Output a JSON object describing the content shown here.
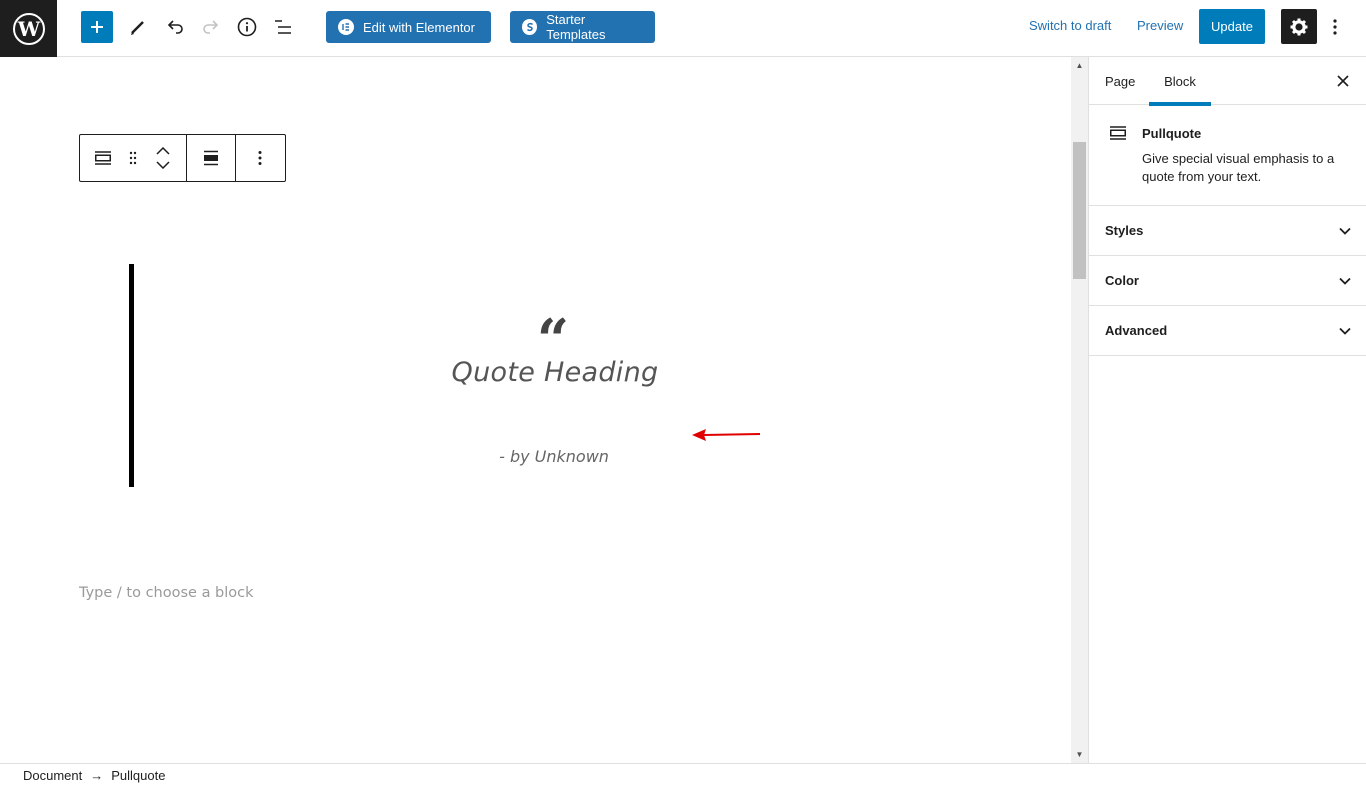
{
  "toolbar": {
    "edit_elementor_label": "Edit with Elementor",
    "starter_templates_label": "Starter Templates",
    "switch_to_draft_label": "Switch to draft",
    "preview_label": "Preview",
    "update_label": "Update"
  },
  "editor": {
    "quote_mark": "“",
    "quote_heading": "Quote Heading",
    "citation": "- by Unknown",
    "placeholder": "Type / to choose a block"
  },
  "sidebar": {
    "tabs": [
      {
        "label": "Page",
        "active": false
      },
      {
        "label": "Block",
        "active": true
      }
    ],
    "block": {
      "title": "Pullquote",
      "description": "Give special visual emphasis to a quote from your text."
    },
    "panels": [
      {
        "label": "Styles"
      },
      {
        "label": "Color"
      },
      {
        "label": "Advanced"
      }
    ]
  },
  "breadcrumb": {
    "root": "Document",
    "separator": "→",
    "current": "Pullquote"
  },
  "colors": {
    "primary": "#007cba",
    "elementor_button": "#2271b1",
    "dark": "#1e1e1e",
    "annotation_arrow": "#e00000"
  }
}
